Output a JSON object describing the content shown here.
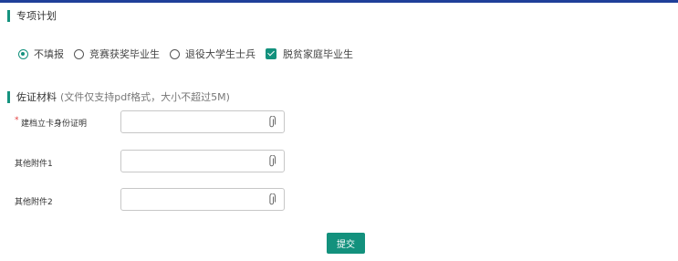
{
  "theme": {
    "accent": "#13917d",
    "section_bar": "#15937f",
    "top_line": "#1f3f99"
  },
  "special_plan": {
    "title": "专项计划",
    "options": [
      {
        "label": "不填报",
        "type": "radio",
        "checked": true
      },
      {
        "label": "竞赛获奖毕业生",
        "type": "radio",
        "checked": false
      },
      {
        "label": "退役大学生士兵",
        "type": "radio",
        "checked": false
      },
      {
        "label": "脱贫家庭毕业生",
        "type": "checkbox",
        "checked": true
      }
    ]
  },
  "materials": {
    "title": "佐证材料",
    "note": "(文件仅支持pdf格式，大小不超过5M)",
    "fields": [
      {
        "required_mark": "*",
        "label": "建档立卡身份证明",
        "icon": "paperclip-icon"
      },
      {
        "required_mark": "",
        "label": "其他附件1",
        "icon": "paperclip-icon"
      },
      {
        "required_mark": "",
        "label": "其他附件2",
        "icon": "paperclip-icon"
      }
    ]
  },
  "submit_label": "提交"
}
